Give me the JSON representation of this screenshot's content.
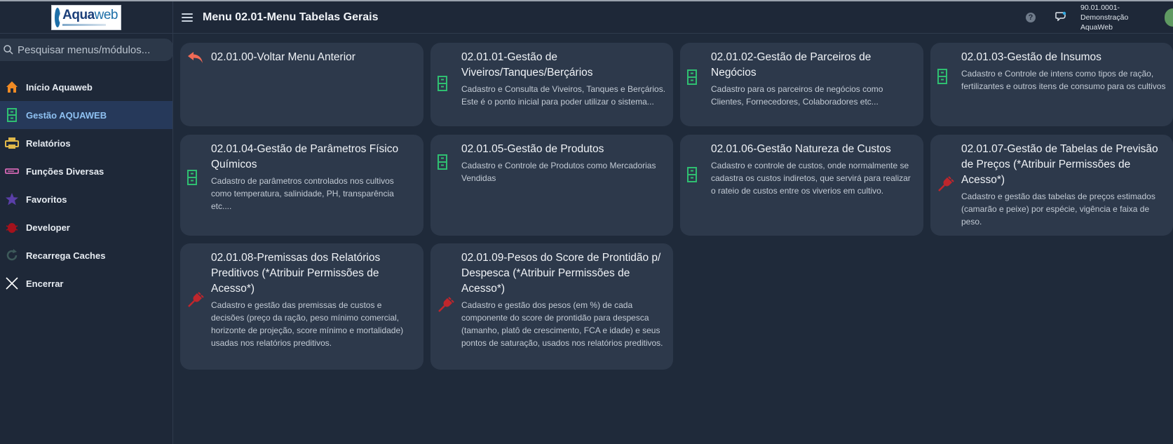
{
  "brand": {
    "logo_name_bold": "Aqua",
    "logo_name_thin": "web"
  },
  "search": {
    "placeholder": "Pesquisar menus/módulos..."
  },
  "sidebar": {
    "items": [
      {
        "label": "Início Aquaweb",
        "icon": "home-icon",
        "color": "#f08a24"
      },
      {
        "label": "Gestão AQUAWEB",
        "icon": "file-cabinet-icon",
        "color": "#2fbf71",
        "active": true
      },
      {
        "label": "Relatórios",
        "icon": "printer-icon",
        "color": "#e0b84a"
      },
      {
        "label": "Funções Diversas",
        "icon": "tag-icon",
        "color": "#d668b5"
      },
      {
        "label": "Favoritos",
        "icon": "star-icon",
        "color": "#5a3fa8"
      },
      {
        "label": "Developer",
        "icon": "bug-icon",
        "color": "#a4121c"
      },
      {
        "label": "Recarrega Caches",
        "icon": "refresh-icon",
        "color": "#3d5a5a"
      },
      {
        "label": "Encerrar",
        "icon": "close-icon",
        "color": "#ffffff"
      }
    ]
  },
  "header": {
    "title": "Menu 02.01-Menu Tabelas Gerais",
    "user_line1": "90.01.0001-",
    "user_line2": "Demonstração",
    "user_line3": "AquaWeb"
  },
  "cards": [
    {
      "title": "02.01.00-Voltar Menu Anterior",
      "desc": "",
      "icon": "back-arrow-icon"
    },
    {
      "title": "02.01.01-Gestão de Viveiros/Tanques/Berçários",
      "desc": "Cadastro e Consulta de Viveiros, Tanques e Berçários. Este é o ponto inicial para poder utilizar o sistema...",
      "icon": "file-cabinet-icon"
    },
    {
      "title": "02.01.02-Gestão de Parceiros de Negócios",
      "desc": "Cadastro para os parceiros de negócios como Clientes, Fornecedores, Colaboradores etc...",
      "icon": "file-cabinet-icon"
    },
    {
      "title": "02.01.03-Gestão de Insumos",
      "desc": "Cadastro e Controle de intens como tipos de ração, fertilizantes e outros itens de consumo para os cultivos",
      "icon": "file-cabinet-icon"
    },
    {
      "title": "02.01.04-Gestão de Parâmetros Físico Químicos",
      "desc": "Cadastro de parâmetros controlados nos cultivos como temperatura, salinidade, PH, transparência etc....",
      "icon": "file-cabinet-icon"
    },
    {
      "title": "02.01.05-Gestão de Produtos",
      "desc": "Cadastro e Controle de Produtos como Mercadorias Vendidas",
      "icon": "file-cabinet-icon"
    },
    {
      "title": "02.01.06-Gestão Natureza de Custos",
      "desc": "Cadastro e controle de custos, onde normalmente se cadastra os custos indiretos, que servirá para realizar o rateio de custos entre os viverios em cultivo.",
      "icon": "file-cabinet-icon"
    },
    {
      "title": "02.01.07-Gestão de Tabelas de Previsão de Preços (*Atribuir Permissões de Acesso*)",
      "desc": "Cadastro e gestão das tabelas de preços estimados (camarão e peixe) por espécie, vigência e faixa de peso.",
      "icon": "red-plug-icon"
    },
    {
      "title": "02.01.08-Premissas dos Relatórios Preditivos (*Atribuir Permissões de Acesso*)",
      "desc": "Cadastro e gestão das premissas de custos e decisões (preço da ração, peso mínimo comercial, horizonte de projeção, score mínimo e mortalidade) usadas nos relatórios preditivos.",
      "icon": "red-plug-icon"
    },
    {
      "title": "02.01.09-Pesos do Score de Prontidão p/ Despesca (*Atribuir Permissões de Acesso*)",
      "desc": "Cadastro e gestão dos pesos (em %) de cada componente do score de prontidão para despesca (tamanho, platô de crescimento, FCA e idade) e seus pontos de saturação, usados nos relatórios preditivos.",
      "icon": "red-plug-icon"
    }
  ],
  "colors": {
    "background": "#1f2a3a",
    "card": "#2d394b",
    "accent_green": "#2fbf71",
    "accent_red": "#c0262c",
    "back_arrow": "#f06a56",
    "active_nav_text": "#8fc1f2"
  }
}
